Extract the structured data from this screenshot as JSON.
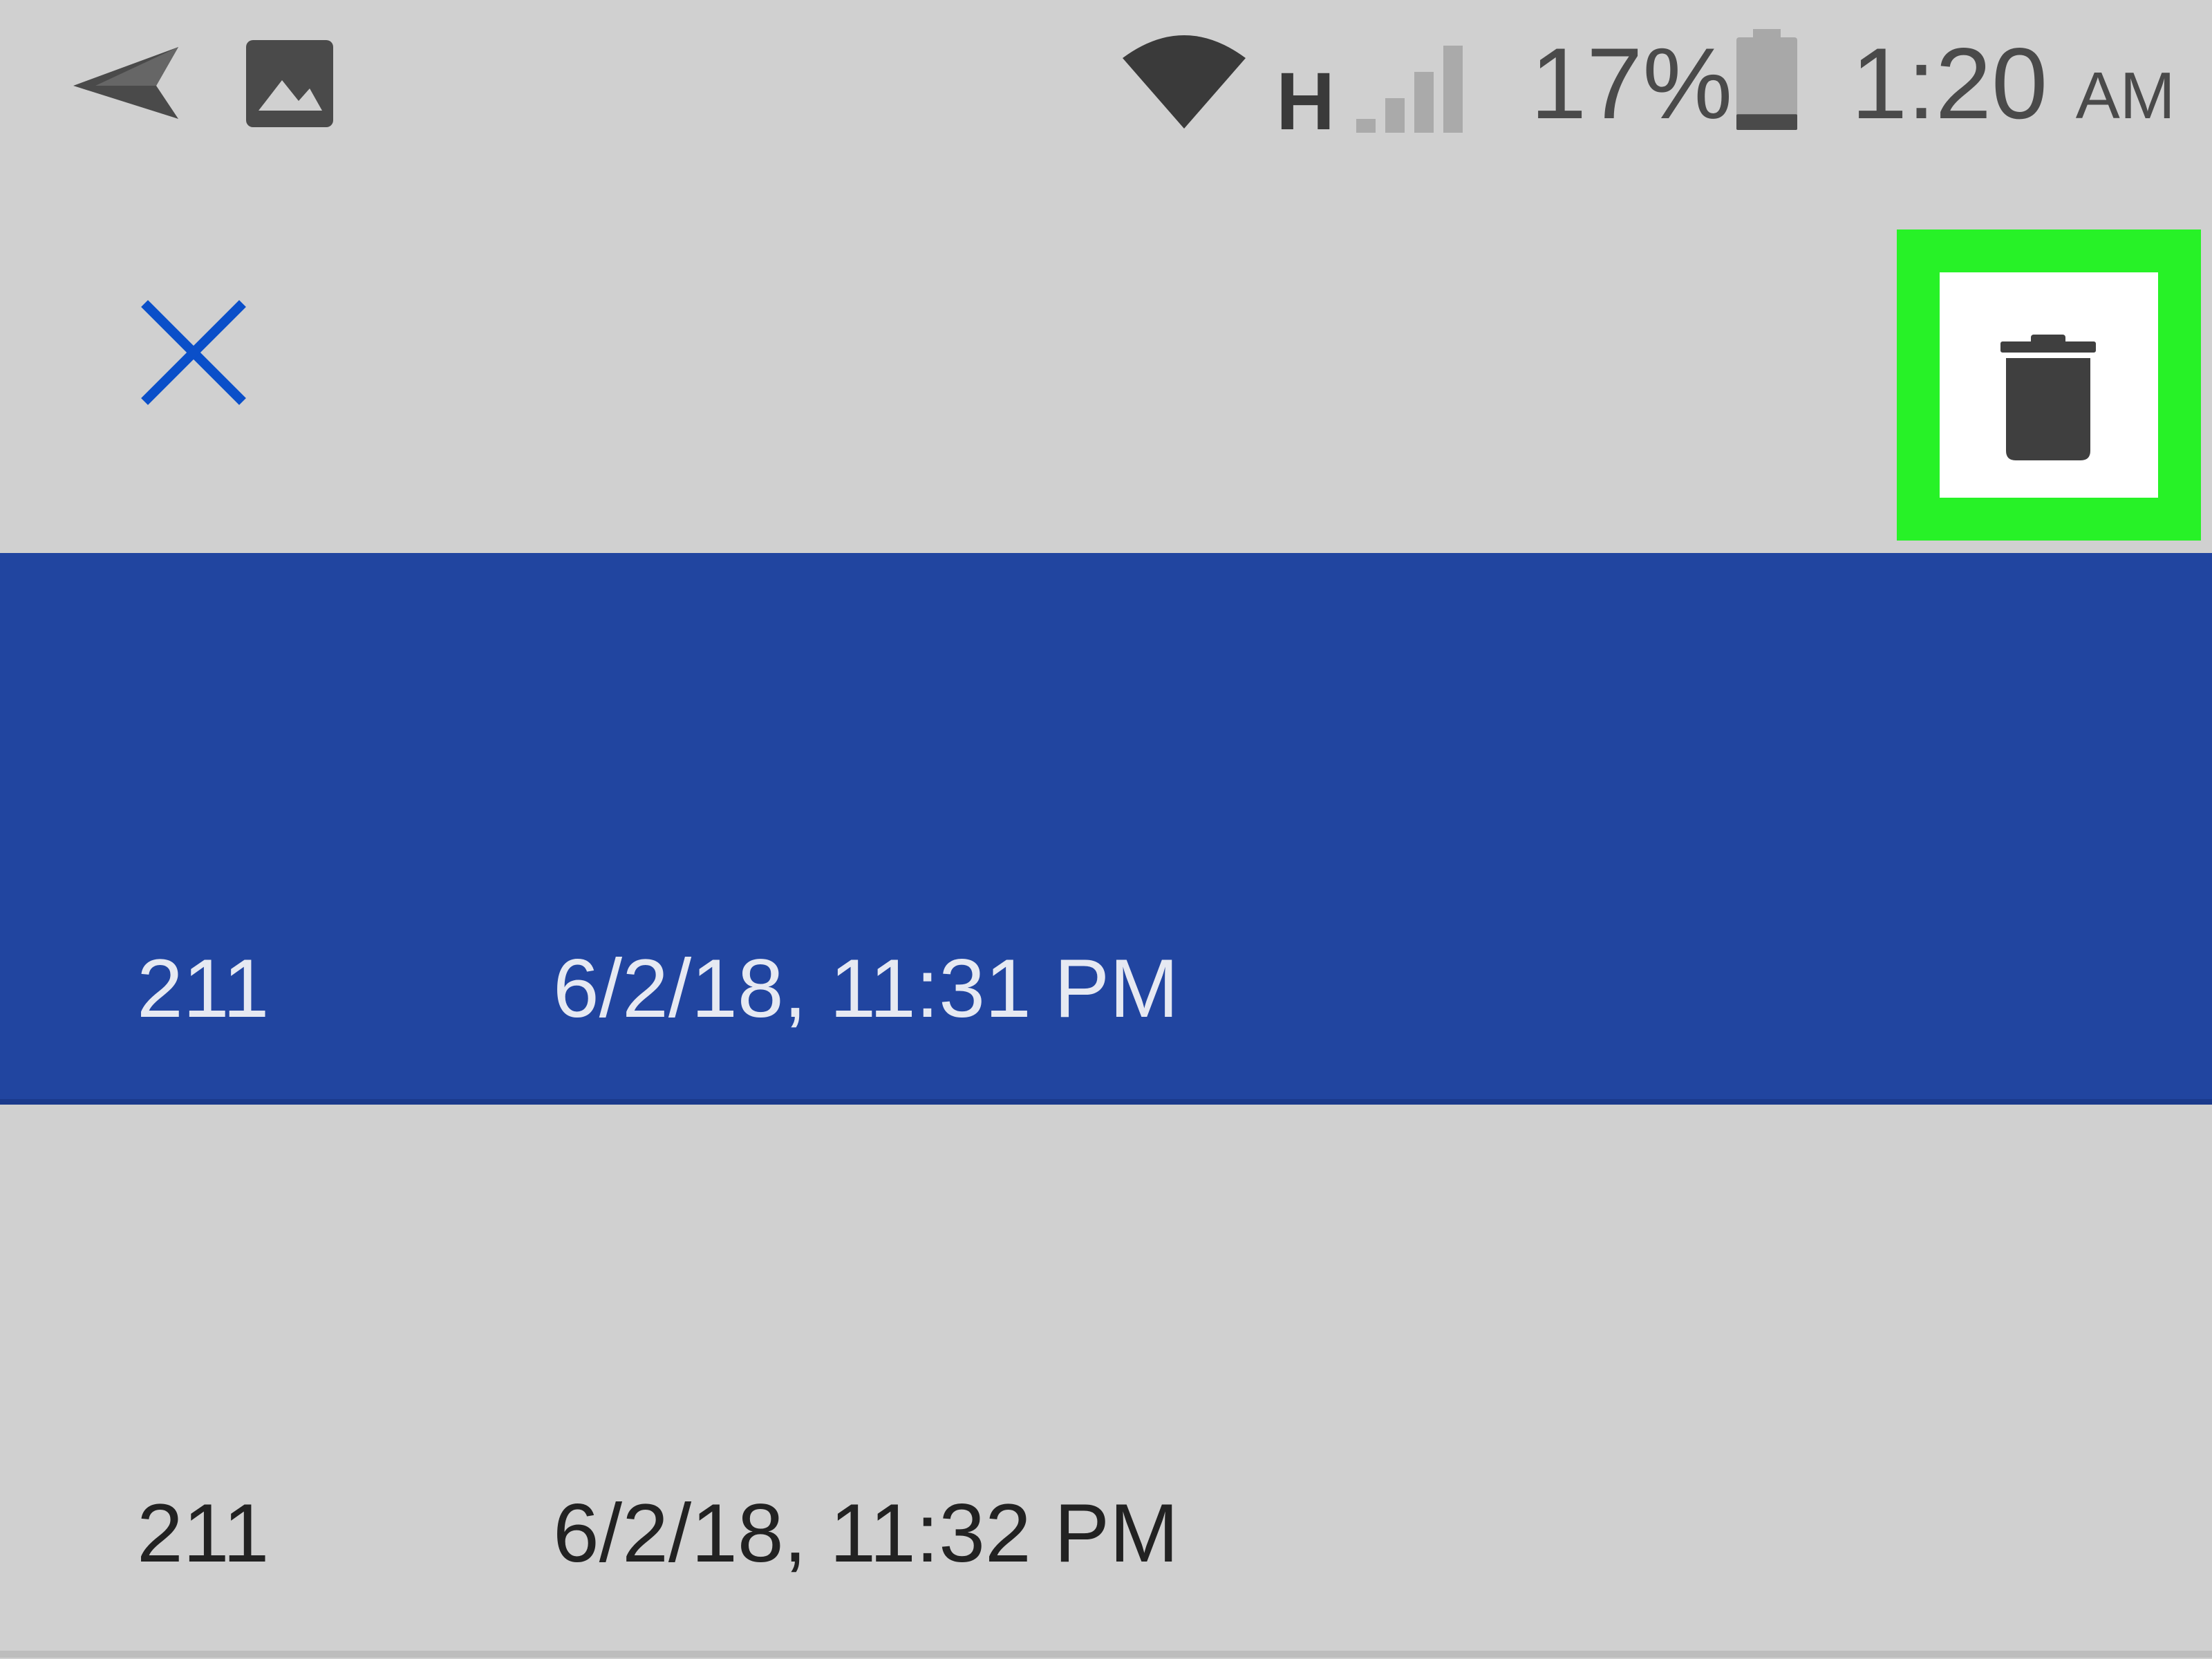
{
  "status_bar": {
    "notification_icons": [
      "send-icon",
      "image-icon"
    ],
    "system_icons": [
      "wifi-icon",
      "signal-icon",
      "battery-icon"
    ],
    "network_type": "H",
    "battery_percent": "17%",
    "battery_level": 0.17,
    "time": "1:20",
    "time_period": "AM"
  },
  "action_bar": {
    "close_icon": "close-icon",
    "delete_icon": "trash-icon",
    "accent_color": "#0a4fc9",
    "highlight_color": "#27f227"
  },
  "messages": [
    {
      "sender": "211",
      "timestamp": "6/2/18, 11:31 PM",
      "selected": true
    },
    {
      "sender": "211",
      "timestamp": "6/2/18, 11:32 PM",
      "selected": false
    }
  ],
  "colors": {
    "background": "#d0d0d0",
    "selected_row": "#2145a0",
    "icon": "#4a4a4a"
  }
}
